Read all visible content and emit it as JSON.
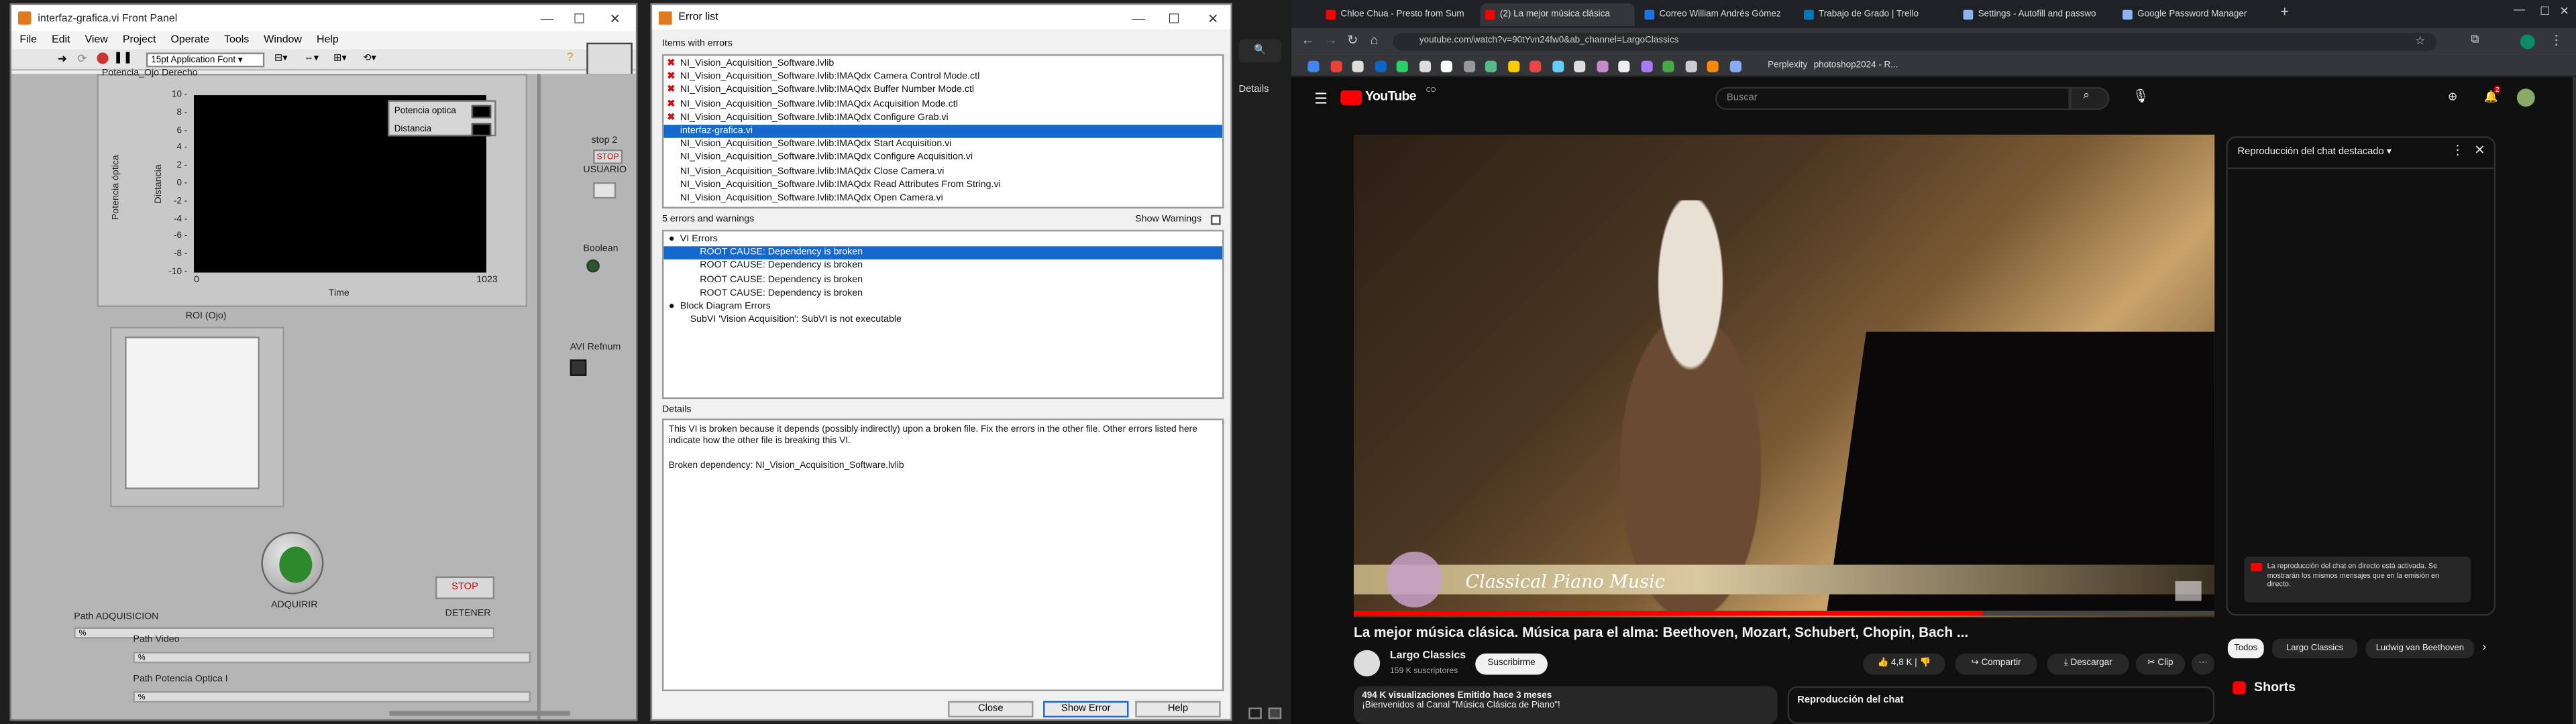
{
  "labview": {
    "title": "interfaz-grafica.vi Front Panel",
    "menu": [
      "File",
      "Edit",
      "View",
      "Project",
      "Operate",
      "Tools",
      "Window",
      "Help"
    ],
    "font_select": "15pt Application Font",
    "graph_label": "Potencia_Ojo Derecho",
    "y_axis_label": "Potencia óptica",
    "y_axis_label2": "Distancia",
    "y_ticks": [
      "10",
      "8",
      "6",
      "4",
      "2",
      "0",
      "-2",
      "-4",
      "-6",
      "-8",
      "-10"
    ],
    "x_tick_min": "0",
    "x_tick_max": "1023",
    "x_axis_label": "Time",
    "legend": [
      "Potencia optica",
      "Distancia"
    ],
    "stop2_label": "stop 2",
    "stop2_btn": "STOP",
    "usuario_label": "USUARIO",
    "boolean_label": "Boolean",
    "avi_label": "AVI Refnum",
    "roi_label": "ROI (Ojo)",
    "adquirir_label": "ADQUIRIR",
    "stop_btn": "STOP",
    "detener_label": "DETENER",
    "path_adq_label": "Path ADQUISICION",
    "path_adq_value": "%",
    "path_video_label": "Path Video",
    "path_video_value": "%",
    "path_pot_label": "Path Potencia Optica I",
    "path_pot_value": "%"
  },
  "errorlist": {
    "title": "Error list",
    "items_header": "Items with errors",
    "items": [
      {
        "text": "NI_Vision_Acquisition_Software.lvlib",
        "error": true,
        "selected": false
      },
      {
        "text": "NI_Vision_Acquisition_Software.lvlib:IMAQdx Camera Control Mode.ctl",
        "error": true,
        "selected": false
      },
      {
        "text": "NI_Vision_Acquisition_Software.lvlib:IMAQdx Buffer Number Mode.ctl",
        "error": true,
        "selected": false
      },
      {
        "text": "NI_Vision_Acquisition_Software.lvlib:IMAQdx Acquisition Mode.ctl",
        "error": true,
        "selected": false
      },
      {
        "text": "NI_Vision_Acquisition_Software.lvlib:IMAQdx Configure Grab.vi",
        "error": true,
        "selected": false
      },
      {
        "text": "interfaz-grafica.vi",
        "error": false,
        "selected": true
      },
      {
        "text": "NI_Vision_Acquisition_Software.lvlib:IMAQdx Start Acquisition.vi",
        "error": false,
        "selected": false
      },
      {
        "text": "NI_Vision_Acquisition_Software.lvlib:IMAQdx Configure Acquisition.vi",
        "error": false,
        "selected": false
      },
      {
        "text": "NI_Vision_Acquisition_Software.lvlib:IMAQdx Close Camera.vi",
        "error": false,
        "selected": false
      },
      {
        "text": "NI_Vision_Acquisition_Software.lvlib:IMAQdx Read Attributes From String.vi",
        "error": false,
        "selected": false
      },
      {
        "text": "NI_Vision_Acquisition_Software.lvlib:IMAQdx Open Camera.vi",
        "error": false,
        "selected": false
      }
    ],
    "errors_header": "5 errors and warnings",
    "show_warnings": "Show Warnings",
    "errors": [
      {
        "text": "VI Errors",
        "indent": 0,
        "bullet": true,
        "selected": false
      },
      {
        "text": "ROOT CAUSE: Dependency is broken",
        "indent": 2,
        "bullet": false,
        "selected": true
      },
      {
        "text": "ROOT CAUSE: Dependency is broken",
        "indent": 2,
        "bullet": false,
        "selected": false
      },
      {
        "text": "ROOT CAUSE: Dependency is broken",
        "indent": 2,
        "bullet": false,
        "selected": false
      },
      {
        "text": "ROOT CAUSE: Dependency is broken",
        "indent": 2,
        "bullet": false,
        "selected": false
      },
      {
        "text": "Block Diagram Errors",
        "indent": 0,
        "bullet": true,
        "selected": false
      },
      {
        "text": "SubVI 'Vision Acquisition': SubVI is not executable",
        "indent": 1,
        "bullet": false,
        "selected": false
      }
    ],
    "details_header": "Details",
    "details_p1": "This VI is broken because it depends (possibly indirectly) upon a broken file. Fix the errors in the other file. Other errors listed here indicate how the other file is breaking this VI.",
    "details_p2": "Broken dependency: NI_Vision_Acquisition_Software.lvlib",
    "btn_close": "Close",
    "btn_show": "Show Error",
    "btn_help": "Help"
  },
  "taskstrip": {
    "details": "Details"
  },
  "chrome": {
    "tabs": [
      {
        "label": "Chloe Chua - Presto from Sum",
        "color": "#ff0000",
        "active": false
      },
      {
        "label": "(2) La mejor música clásica",
        "color": "#ff0000",
        "active": true
      },
      {
        "label": "Correo William Andrés Gómez",
        "color": "#1a73e8",
        "active": false
      },
      {
        "label": "Trabajo de Grado | Trello",
        "color": "#0079bf",
        "active": false
      },
      {
        "label": "Settings - Autofill and passwo",
        "color": "#8ab4f8",
        "active": false
      },
      {
        "label": "Google Password Manager",
        "color": "#8ab4f8",
        "active": false
      }
    ],
    "url": "youtube.com/watch?v=90tYvn24fw0&ab_channel=LargoClassics",
    "bookmarks": [
      "Perplexity",
      "photoshop2024 - R..."
    ]
  },
  "youtube": {
    "logo": "YouTube",
    "logo_sup": "CO",
    "search_placeholder": "Buscar",
    "video_overlay": "Classical Piano Music",
    "title": "La mejor música clásica. Música para el alma: Beethoven, Mozart, Schubert, Chopin, Bach ...",
    "channel": "Largo Classics",
    "subs": "159 K suscriptores",
    "subscribe": "Suscribirme",
    "likes": "4,8 K",
    "share": "Compartir",
    "download": "Descargar",
    "clip": "Clip",
    "views": "494 K visualizaciones  Emitido hace 3 meses",
    "desc_line": "¡Bienvenidos al Canal \"Música Clásica de Piano\"!",
    "chat_replay_label": "Reproducción del chat",
    "chat_header": "Reproducción del chat destacado",
    "chat_note": "La reproducción del chat en directo está activada. Se mostrarán los mismos mensajes que en la emisión en directo.",
    "chips": [
      "Todos",
      "Largo Classics",
      "Ludwig van Beethoven"
    ],
    "shorts": "Shorts",
    "notif_count": "2"
  }
}
